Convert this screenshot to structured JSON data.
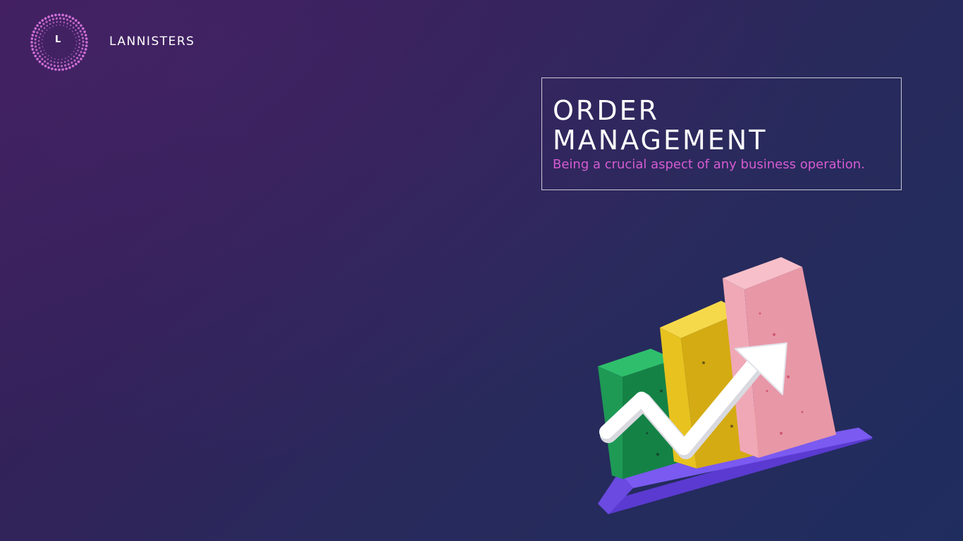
{
  "brand": {
    "logo_letter": "L",
    "name": "LANNISTERS"
  },
  "hero": {
    "title_line1": "ORDER",
    "title_line2": "MANAGEMENT",
    "subtitle": "Being a crucial aspect of any business operation."
  },
  "colors": {
    "accent": "#d65bd1",
    "logo_ring": "#d070d8",
    "bar_green": "#1e9a55",
    "bar_yellow": "#e8c21e",
    "bar_pink": "#f0a8b6",
    "base_purple": "#6a4ae0"
  },
  "illustration": {
    "icon": "growth-bar-chart-icon"
  }
}
